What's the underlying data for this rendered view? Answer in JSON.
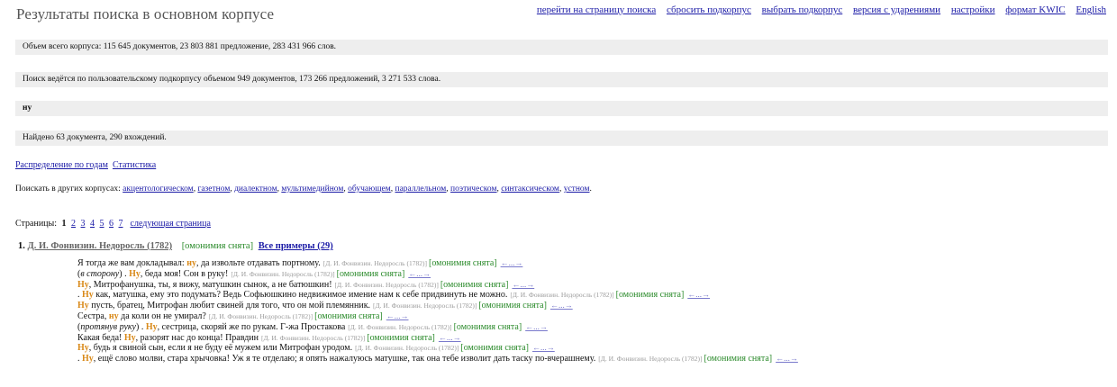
{
  "title": "Результаты поиска в основном корпусе",
  "top_links": [
    "перейти на страницу поиска",
    "сбросить подкорпус",
    "выбрать подкорпус",
    "версия с ударениями",
    "настройки",
    "формат KWIC",
    "English"
  ],
  "bars": {
    "corpus_size": "Объем всего корпуса: 115 645 документов, 23 803 881 предложение, 283 431 966 слов.",
    "subcorpus": "Поиск ведётся по пользовательскому подкорпусу объемом 949 документов, 173 266 предложений, 3 271 533 слова.",
    "query": "ну",
    "found": "Найдено 63 документа, 290 вхождений."
  },
  "stats_links": {
    "by_years": "Распределение по годам",
    "statistics": "Статистика"
  },
  "other_corpora": {
    "label": "Поискать в других корпусах:",
    "links": [
      "акцентологическом",
      "газетном",
      "диалектном",
      "мультимедийном",
      "обучающем",
      "параллельном",
      "поэтическом",
      "синтаксическом",
      "устном"
    ],
    "end": "."
  },
  "pagination": {
    "label": "Страницы:",
    "current": "1",
    "pages": [
      "2",
      "3",
      "4",
      "5",
      "6",
      "7"
    ],
    "next": "следующая страница"
  },
  "result": {
    "number": "1.",
    "doc": "Д. И. Фонвизин. Недоросль (1782)",
    "homonymy": "[омонимия снята]",
    "all_examples": "Все примеры (29)"
  },
  "snippets": [
    {
      "pre": "Я тогда же вам докладывал: ",
      "hit": "ну",
      "post": ", да извольте отдавать портному."
    },
    {
      "pre": "(",
      "italic": "в сторону",
      "pre2": ") . ",
      "hit": "Ну",
      "post": ", беда моя! Сон в руку!"
    },
    {
      "pre": "",
      "hit": "Ну",
      "post": ", Митрофанушка, ты, я вижу, матушкин сынок, а не батюшкин!"
    },
    {
      "pre": ". ",
      "hit": "Ну",
      "post": " как, матушка, ему это подумать? Ведь Софьюшкино недвижимое имение нам к себе придвинуть не можно."
    },
    {
      "pre": "",
      "hit": "Ну",
      "post": " пусть, братец, Митрофан любит свиней для того, что он мой племянник."
    },
    {
      "pre": "Сестра, ",
      "hit": "ну",
      "post": " да коли он не умирал?"
    },
    {
      "pre": "(",
      "italic": "протянув руку",
      "pre2": ") . ",
      "hit": "Ну",
      "post": ", сестрица, скоряй же по рукам. Г-жа Простакова"
    },
    {
      "pre": "Какая беда! ",
      "hit": "Ну",
      "post": ", разорят нас до конца! Правдин"
    },
    {
      "pre": "",
      "hit": "Ну",
      "post": ", будь я свиной сын, если я не буду её мужем или Митрофан уродом."
    },
    {
      "pre": ". ",
      "hit": "Ну",
      "post": ", ещё слово молви, стара хрычовка! Уж я те отделаю; я опять нажалуюсь матушке, так она тебе изволит дать таску по-вчерашнему."
    }
  ],
  "snippet_source": "[Д. И. Фонвизин. Недоросль (1782)]",
  "snippet_homonymy": "[омонимия снята]",
  "snippet_nav": "←...→",
  "colors": {
    "link": "#1a1aa6",
    "hit": "#d98a1a",
    "homonymy": "#2a8a2a",
    "bar": "#eeeeee"
  }
}
